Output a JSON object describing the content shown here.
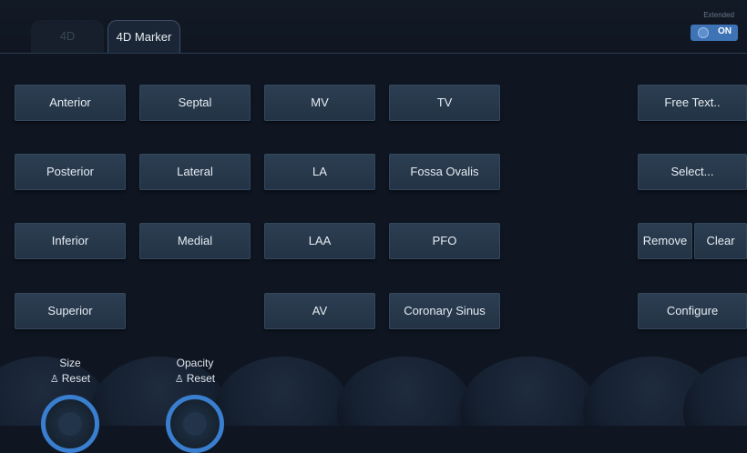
{
  "tabs": [
    {
      "label": "4D",
      "active": false
    },
    {
      "label": "4D Marker",
      "active": true
    }
  ],
  "extended": {
    "label": "Extended",
    "state": "ON",
    "accent": "#3e73b5"
  },
  "markers": {
    "anterior": "Anterior",
    "septal": "Septal",
    "mv": "MV",
    "tv": "TV",
    "posterior": "Posterior",
    "lateral": "Lateral",
    "la": "LA",
    "fossa_ovalis": "Fossa Ovalis",
    "inferior": "Inferior",
    "medial": "Medial",
    "laa": "LAA",
    "pfo": "PFO",
    "superior": "Superior",
    "av": "AV",
    "coronary_sinus": "Coronary Sinus"
  },
  "actions": {
    "free_text": "Free Text..",
    "select": "Select...",
    "remove": "Remove",
    "clear": "Clear",
    "configure": "Configure"
  },
  "knobs": [
    {
      "label": "Size",
      "reset": "Reset",
      "icon": "person-icon"
    },
    {
      "label": "Opacity",
      "reset": "Reset",
      "icon": "person-icon"
    }
  ]
}
